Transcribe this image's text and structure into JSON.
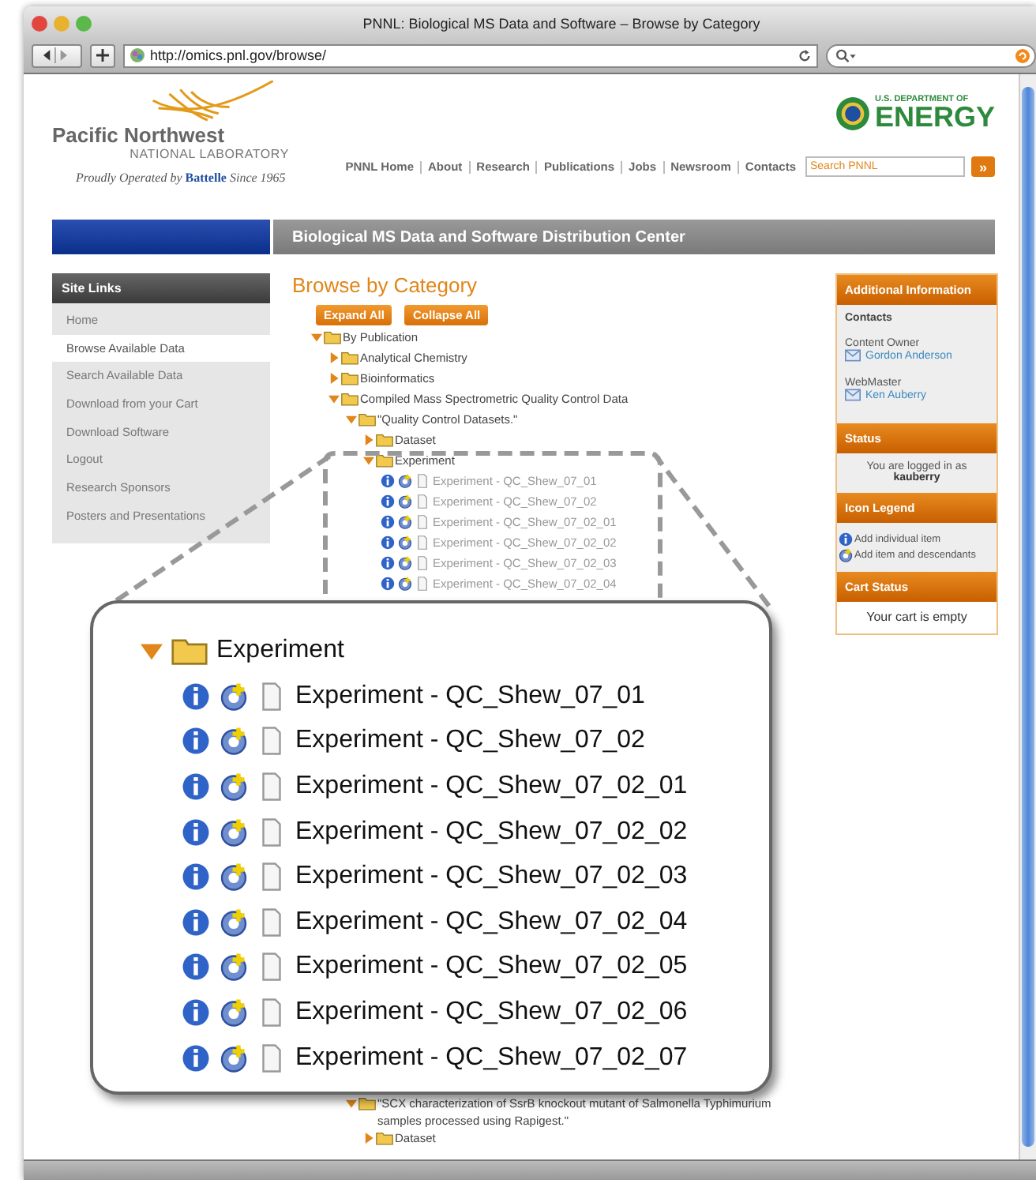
{
  "window": {
    "title": "PNNL: Biological MS Data and Software – Browse by Category"
  },
  "toolbar": {
    "url": "http://omics.pnl.gov/browse/"
  },
  "header": {
    "logo_name": "Pacific Northwest",
    "logo_sub": "NATIONAL LABORATORY",
    "tagline": "Proudly Operated by **Battelle** Since 1965",
    "doe_top": "U.S. DEPARTMENT OF",
    "doe_name": "ENERGY",
    "nav": [
      "PNNL Home",
      "About",
      "Research",
      "Publications",
      "Jobs",
      "Newsroom",
      "Contacts"
    ],
    "search": {
      "placeholder": "Search PNNL"
    },
    "search_button": "»"
  },
  "banner": {
    "title": "Biological MS Data and Software Distribution Center"
  },
  "site_links": {
    "title": "Site Links",
    "items": [
      {
        "label": "Home",
        "selected": false
      },
      {
        "label": "Browse Available Data",
        "selected": true
      },
      {
        "label": "Search Available Data",
        "selected": false
      },
      {
        "label": "Download from your Cart",
        "selected": false
      },
      {
        "label": "Download Software",
        "selected": false
      },
      {
        "label": "Logout",
        "selected": false
      },
      {
        "label": "Research Sponsors",
        "selected": false
      },
      {
        "label": "Posters and Presentations",
        "selected": false
      }
    ]
  },
  "main": {
    "heading": "Browse by Category",
    "buttons": [
      "Expand All",
      "Collapse All"
    ],
    "tree": [
      {
        "kind": "folder",
        "label": "By Publication",
        "expanded": true,
        "children": [
          {
            "kind": "folder",
            "label": "Analytical Chemistry",
            "expanded": false
          },
          {
            "kind": "folder",
            "label": "Bioinformatics",
            "expanded": false
          },
          {
            "kind": "folder",
            "label": "Compiled Mass Spectrometric Quality Control Data",
            "expanded": true,
            "children": [
              {
                "kind": "folder",
                "label": "\"Quality Control Datasets.\"",
                "expanded": true,
                "children": [
                  {
                    "kind": "folder",
                    "label": "Dataset",
                    "expanded": false
                  },
                  {
                    "kind": "folder",
                    "label": "Experiment",
                    "expanded": true,
                    "children": [
                      {
                        "kind": "item",
                        "label": "Experiment - QC_Shew_07_01"
                      },
                      {
                        "kind": "item",
                        "label": "Experiment - QC_Shew_07_02"
                      },
                      {
                        "kind": "item",
                        "label": "Experiment - QC_Shew_07_02_01"
                      },
                      {
                        "kind": "item",
                        "label": "Experiment - QC_Shew_07_02_02"
                      },
                      {
                        "kind": "item",
                        "label": "Experiment - QC_Shew_07_02_03"
                      },
                      {
                        "kind": "item",
                        "label": "Experiment - QC_Shew_07_02_04"
                      }
                    ]
                  }
                ]
              }
            ]
          },
          {
            "kind": "covered",
            "children": [
              {
                "kind": "folder",
                "label": "\"SCX characterization of SsrB knockout mutant of Salmonella Typhimurium samples processed using Rapigest.\"",
                "expanded": true,
                "children": [
                  {
                    "kind": "folder",
                    "label": "Dataset",
                    "expanded": false
                  }
                ]
              }
            ]
          }
        ]
      }
    ]
  },
  "sidebar": [
    {
      "kind": "contacts",
      "title": "Additional Information",
      "heading": "Contacts",
      "groups": [
        {
          "role": "Content Owner",
          "name": "Gordon Anderson"
        },
        {
          "role": "WebMaster",
          "name": "Ken Auberry"
        }
      ]
    },
    {
      "kind": "login",
      "title": "Status",
      "text": "You are logged in as",
      "user": "kauberry"
    },
    {
      "kind": "legend",
      "title": "Icon Legend",
      "entries": [
        {
          "kind": "info",
          "label": "Add individual item"
        },
        {
          "kind": "add",
          "label": "Add item and descendants"
        }
      ]
    },
    {
      "kind": "text",
      "title": "Cart Status",
      "text": "Your cart is empty"
    }
  ],
  "magnifier": {
    "folder": {
      "label": "Experiment",
      "expanded": true
    },
    "items": [
      "Experiment - QC_Shew_07_01",
      "Experiment - QC_Shew_07_02",
      "Experiment - QC_Shew_07_02_01",
      "Experiment - QC_Shew_07_02_02",
      "Experiment - QC_Shew_07_02_03",
      "Experiment - QC_Shew_07_02_04",
      "Experiment - QC_Shew_07_02_05",
      "Experiment - QC_Shew_07_02_06",
      "Experiment - QC_Shew_07_02_07"
    ]
  }
}
